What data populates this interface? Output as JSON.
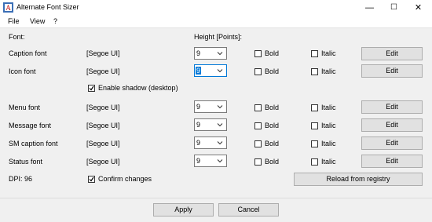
{
  "window": {
    "title": "Alternate Font Sizer",
    "controls": [
      "—",
      "☐",
      "✕"
    ]
  },
  "menu": [
    "File",
    "View",
    "?"
  ],
  "headers": {
    "font": "Font:",
    "height": "Height [Points]:"
  },
  "rows": [
    {
      "label": "Caption font",
      "face": "[Segoe UI]",
      "size": "9",
      "bold": "Bold",
      "italic": "Italic",
      "edit": "Edit"
    },
    {
      "label": "Icon font",
      "face": "[Segoe UI]",
      "size": "9",
      "bold": "Bold",
      "italic": "Italic",
      "edit": "Edit"
    },
    {
      "label": "Menu font",
      "face": "[Segoe UI]",
      "size": "9",
      "bold": "Bold",
      "italic": "Italic",
      "edit": "Edit"
    },
    {
      "label": "Message font",
      "face": "[Segoe UI]",
      "size": "9",
      "bold": "Bold",
      "italic": "Italic",
      "edit": "Edit"
    },
    {
      "label": "SM caption font",
      "face": "[Segoe UI]",
      "size": "9",
      "bold": "Bold",
      "italic": "Italic",
      "edit": "Edit"
    },
    {
      "label": "Status font",
      "face": "[Segoe UI]",
      "size": "9",
      "bold": "Bold",
      "italic": "Italic",
      "edit": "Edit"
    }
  ],
  "enable_shadow": {
    "label": "Enable shadow (desktop)",
    "checked": true
  },
  "dpi": "DPI: 96",
  "confirm_changes": {
    "label": "Confirm changes",
    "checked": true
  },
  "reload_label": "Reload from registry",
  "footer": {
    "apply": "Apply",
    "cancel": "Cancel"
  },
  "colors": {
    "accent": "#0078d7",
    "button_bg": "#e1e1e1",
    "window_bg": "#f0f0f0"
  }
}
